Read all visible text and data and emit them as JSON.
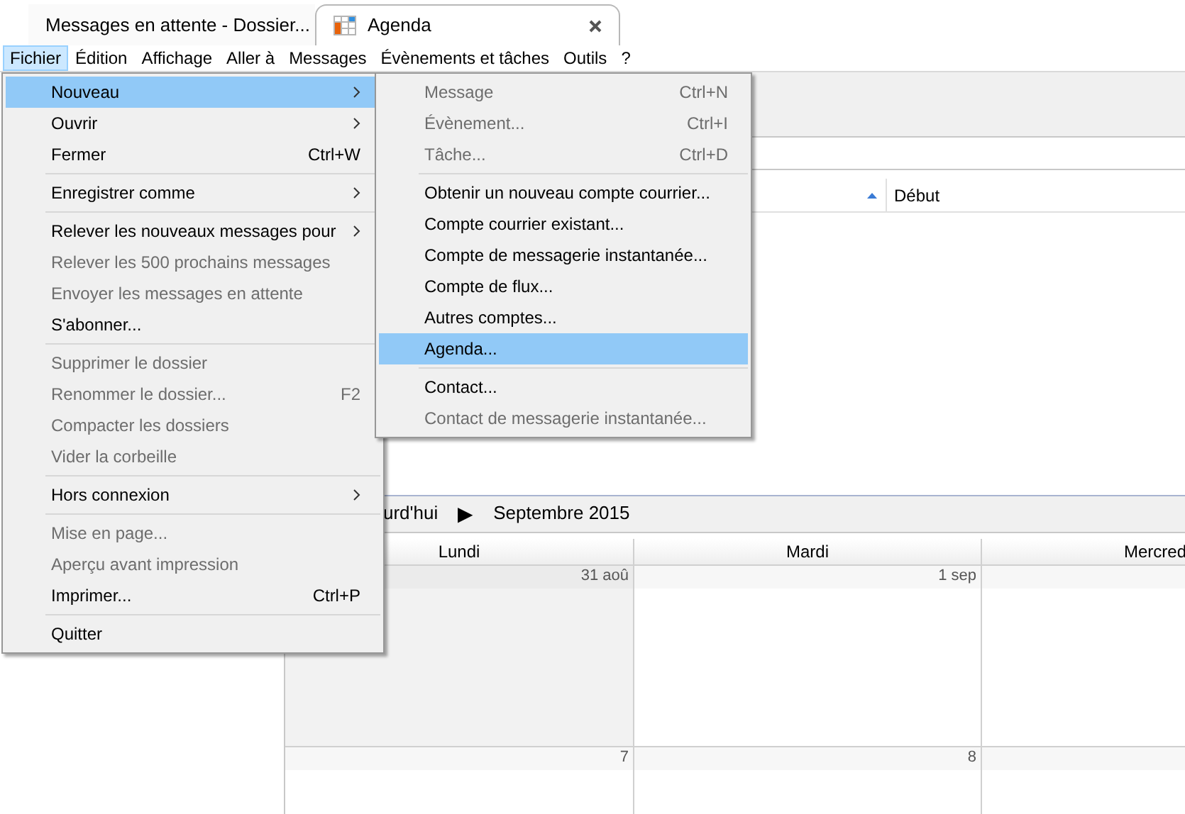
{
  "tabs": [
    {
      "label": "Messages en attente - Dossier...",
      "kind": "mail",
      "selected": false
    },
    {
      "label": "Agenda",
      "kind": "calendar",
      "selected": true
    }
  ],
  "menubar": [
    {
      "label": "Fichier",
      "selected": true
    },
    {
      "label": "Édition",
      "selected": false
    },
    {
      "label": "Affichage",
      "selected": false
    },
    {
      "label": "Aller à",
      "selected": false
    },
    {
      "label": "Messages",
      "selected": false
    },
    {
      "label": "Évènements et tâches",
      "selected": false
    },
    {
      "label": "Outils",
      "selected": false
    },
    {
      "label": "?",
      "selected": false
    }
  ],
  "file_menu": [
    {
      "kind": "item",
      "label": "Nouveau",
      "submenu": true,
      "disabled": false,
      "selected": true
    },
    {
      "kind": "item",
      "label": "Ouvrir",
      "submenu": true,
      "disabled": false,
      "selected": false
    },
    {
      "kind": "item",
      "label": "Fermer",
      "shortcut": "Ctrl+W",
      "disabled": false,
      "selected": false
    },
    {
      "kind": "separator"
    },
    {
      "kind": "item",
      "label": "Enregistrer comme",
      "submenu": true,
      "disabled": false,
      "selected": false
    },
    {
      "kind": "separator"
    },
    {
      "kind": "item",
      "label": "Relever les nouveaux messages pour",
      "submenu": true,
      "disabled": false,
      "selected": false
    },
    {
      "kind": "item",
      "label": "Relever les 500 prochains messages",
      "disabled": true,
      "selected": false
    },
    {
      "kind": "item",
      "label": "Envoyer les messages en attente",
      "disabled": true,
      "selected": false
    },
    {
      "kind": "item",
      "label": "S'abonner...",
      "disabled": false,
      "selected": false
    },
    {
      "kind": "separator"
    },
    {
      "kind": "item",
      "label": "Supprimer le dossier",
      "disabled": true,
      "selected": false
    },
    {
      "kind": "item",
      "label": "Renommer le dossier...",
      "shortcut": "F2",
      "disabled": true,
      "selected": false
    },
    {
      "kind": "item",
      "label": "Compacter les dossiers",
      "disabled": true,
      "selected": false
    },
    {
      "kind": "item",
      "label": "Vider la corbeille",
      "disabled": true,
      "selected": false
    },
    {
      "kind": "separator"
    },
    {
      "kind": "item",
      "label": "Hors connexion",
      "submenu": true,
      "disabled": false,
      "selected": false
    },
    {
      "kind": "separator"
    },
    {
      "kind": "item",
      "label": "Mise en page...",
      "disabled": true,
      "selected": false
    },
    {
      "kind": "item",
      "label": "Aperçu avant impression",
      "disabled": true,
      "selected": false
    },
    {
      "kind": "item",
      "label": "Imprimer...",
      "shortcut": "Ctrl+P",
      "disabled": false,
      "selected": false
    },
    {
      "kind": "separator"
    },
    {
      "kind": "item",
      "label": "Quitter",
      "disabled": false,
      "selected": false
    }
  ],
  "new_submenu": [
    {
      "kind": "item",
      "label": "Message",
      "shortcut": "Ctrl+N",
      "disabled": true,
      "selected": false
    },
    {
      "kind": "item",
      "label": "Évènement...",
      "shortcut": "Ctrl+I",
      "disabled": true,
      "selected": false
    },
    {
      "kind": "item",
      "label": "Tâche...",
      "shortcut": "Ctrl+D",
      "disabled": true,
      "selected": false
    },
    {
      "kind": "separator"
    },
    {
      "kind": "item",
      "label": "Obtenir un nouveau compte courrier...",
      "disabled": false,
      "selected": false
    },
    {
      "kind": "item",
      "label": "Compte courrier existant...",
      "disabled": false,
      "selected": false
    },
    {
      "kind": "item",
      "label": "Compte de messagerie instantanée...",
      "disabled": false,
      "selected": false
    },
    {
      "kind": "item",
      "label": "Compte de flux...",
      "disabled": false,
      "selected": false
    },
    {
      "kind": "item",
      "label": "Autres comptes...",
      "disabled": false,
      "selected": false
    },
    {
      "kind": "item",
      "label": "Agenda...",
      "disabled": false,
      "selected": true
    },
    {
      "kind": "separator"
    },
    {
      "kind": "item",
      "label": "Contact...",
      "disabled": false,
      "selected": false
    },
    {
      "kind": "item",
      "label": "Contact de messagerie instantanée...",
      "disabled": true,
      "selected": false
    }
  ],
  "task_list": {
    "columns": [
      {
        "sorted": true
      },
      {
        "label": "Début",
        "sorted": false
      }
    ]
  },
  "calendar": {
    "today": "urd'hui",
    "next": "▶",
    "title": "Septembre 2015",
    "days": [
      "Lundi",
      "Mardi",
      "Mercred"
    ],
    "weeks": [
      [
        {
          "date": "31 aoû",
          "other_month": true
        },
        {
          "date": "1 sep",
          "other_month": false
        }
      ],
      [
        {
          "date": "7",
          "other_month": false
        },
        {
          "date": "8",
          "other_month": false
        }
      ]
    ]
  }
}
